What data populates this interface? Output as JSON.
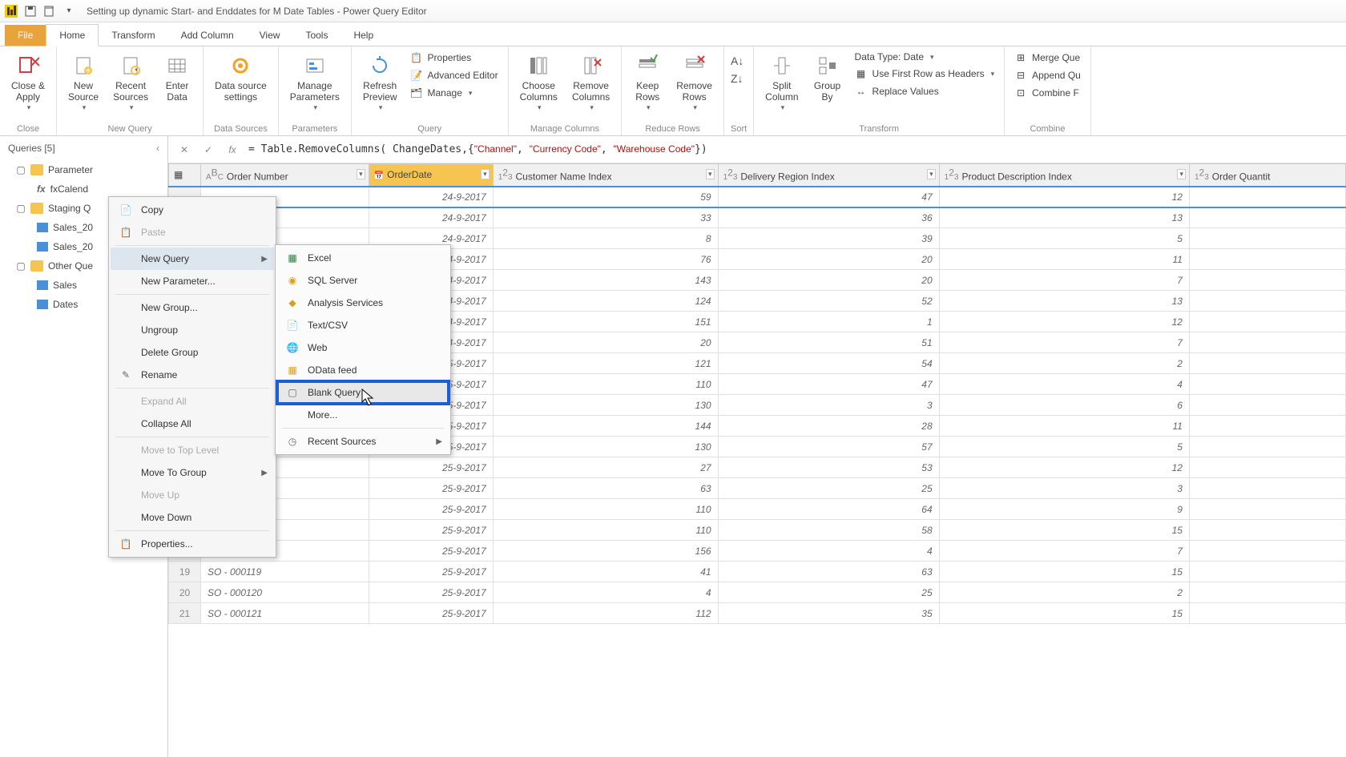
{
  "title": "Setting up dynamic Start- and Enddates for M Date Tables - Power Query Editor",
  "tabs": {
    "file": "File",
    "home": "Home",
    "transform": "Transform",
    "addcol": "Add Column",
    "view": "View",
    "tools": "Tools",
    "help": "Help"
  },
  "ribbon": {
    "close": {
      "close_apply": "Close &\nApply",
      "group": "Close"
    },
    "newquery": {
      "new_source": "New\nSource",
      "recent": "Recent\nSources",
      "enter": "Enter\nData",
      "group": "New Query"
    },
    "datasources": {
      "settings": "Data source\nsettings",
      "group": "Data Sources"
    },
    "parameters": {
      "manage": "Manage\nParameters",
      "group": "Parameters"
    },
    "query": {
      "refresh": "Refresh\nPreview",
      "properties": "Properties",
      "advanced": "Advanced Editor",
      "manage": "Manage",
      "group": "Query"
    },
    "cols": {
      "choose": "Choose\nColumns",
      "remove": "Remove\nColumns",
      "group": "Manage Columns"
    },
    "rows": {
      "keep": "Keep\nRows",
      "remove": "Remove\nRows",
      "group": "Reduce Rows"
    },
    "sort": {
      "group": "Sort"
    },
    "transform": {
      "split": "Split\nColumn",
      "groupby": "Group\nBy",
      "datatype": "Data Type: Date",
      "firstrow": "Use First Row as Headers",
      "replace": "Replace Values",
      "group": "Transform"
    },
    "combine": {
      "merge": "Merge Que",
      "append": "Append Qu",
      "combine": "Combine F",
      "group": "Combine"
    }
  },
  "queries": {
    "header": "Queries [5]",
    "param": "Parameter",
    "fx": "fxCalend",
    "staging": "Staging Q",
    "sales1": "Sales_20",
    "sales2": "Sales_20",
    "other": "Other Que",
    "sales": "Sales",
    "dates": "Dates"
  },
  "formula_prefix": "= Table.RemoveColumns( ChangeDates,{",
  "formula_strings": [
    "\"Channel\"",
    "\"Currency Code\"",
    "\"Warehouse Code\""
  ],
  "formula_suffix": "})",
  "columns": {
    "ordernum": "Order Number",
    "orderdate": "OrderDate",
    "custname": "Customer Name Index",
    "delivery": "Delivery Region Index",
    "product": "Product Description Index",
    "qty": "Order Quantit"
  },
  "rows": [
    {
      "n": "",
      "on": "",
      "date": "24-9-2017",
      "c": "59",
      "d": "47",
      "p": "12"
    },
    {
      "n": "",
      "on": "",
      "date": "24-9-2017",
      "c": "33",
      "d": "36",
      "p": "13"
    },
    {
      "n": "",
      "on": "",
      "date": "24-9-2017",
      "c": "8",
      "d": "39",
      "p": "5"
    },
    {
      "n": "",
      "on": "",
      "date": "24-9-2017",
      "c": "76",
      "d": "20",
      "p": "11"
    },
    {
      "n": "",
      "on": "",
      "date": "24-9-2017",
      "c": "143",
      "d": "20",
      "p": "7"
    },
    {
      "n": "",
      "on": "",
      "date": "24-9-2017",
      "c": "124",
      "d": "52",
      "p": "13"
    },
    {
      "n": "",
      "on": "",
      "date": "24-9-2017",
      "c": "151",
      "d": "1",
      "p": "12"
    },
    {
      "n": "",
      "on": "",
      "date": "24-9-2017",
      "c": "20",
      "d": "51",
      "p": "7"
    },
    {
      "n": "",
      "on": "",
      "date": "25-9-2017",
      "c": "121",
      "d": "54",
      "p": "2"
    },
    {
      "n": "",
      "on": "",
      "date": "25-9-2017",
      "c": "110",
      "d": "47",
      "p": "4"
    },
    {
      "n": "",
      "on": "",
      "date": "25-9-2017",
      "c": "130",
      "d": "3",
      "p": "6"
    },
    {
      "n": "",
      "on": "",
      "date": "25-9-2017",
      "c": "144",
      "d": "28",
      "p": "11"
    },
    {
      "n": "",
      "on": "",
      "date": "25-9-2017",
      "c": "130",
      "d": "57",
      "p": "5"
    },
    {
      "n": "",
      "on": "",
      "date": "25-9-2017",
      "c": "27",
      "d": "53",
      "p": "12"
    },
    {
      "n": "",
      "on": "",
      "date": "25-9-2017",
      "c": "63",
      "d": "25",
      "p": "3"
    },
    {
      "n": "",
      "on": "",
      "date": "25-9-2017",
      "c": "110",
      "d": "64",
      "p": "9"
    },
    {
      "n": "",
      "on": "",
      "date": "25-9-2017",
      "c": "110",
      "d": "58",
      "p": "15"
    },
    {
      "n": "18",
      "on": "SO - 000118",
      "date": "25-9-2017",
      "c": "156",
      "d": "4",
      "p": "7"
    },
    {
      "n": "19",
      "on": "SO - 000119",
      "date": "25-9-2017",
      "c": "41",
      "d": "63",
      "p": "15"
    },
    {
      "n": "20",
      "on": "SO - 000120",
      "date": "25-9-2017",
      "c": "4",
      "d": "25",
      "p": "2"
    },
    {
      "n": "21",
      "on": "SO - 000121",
      "date": "25-9-2017",
      "c": "112",
      "d": "35",
      "p": "15"
    }
  ],
  "ctx": {
    "copy": "Copy",
    "paste": "Paste",
    "newquery": "New Query",
    "newparam": "New Parameter...",
    "newgroup": "New Group...",
    "ungroup": "Ungroup",
    "deletegroup": "Delete Group",
    "rename": "Rename",
    "expand": "Expand All",
    "collapse": "Collapse All",
    "movetop": "Move to Top Level",
    "movegroup": "Move To Group",
    "moveup": "Move Up",
    "movedown": "Move Down",
    "properties": "Properties..."
  },
  "sub": {
    "excel": "Excel",
    "sql": "SQL Server",
    "analysis": "Analysis Services",
    "csv": "Text/CSV",
    "web": "Web",
    "odata": "OData feed",
    "blank": "Blank Query",
    "more": "More...",
    "recent": "Recent Sources"
  }
}
